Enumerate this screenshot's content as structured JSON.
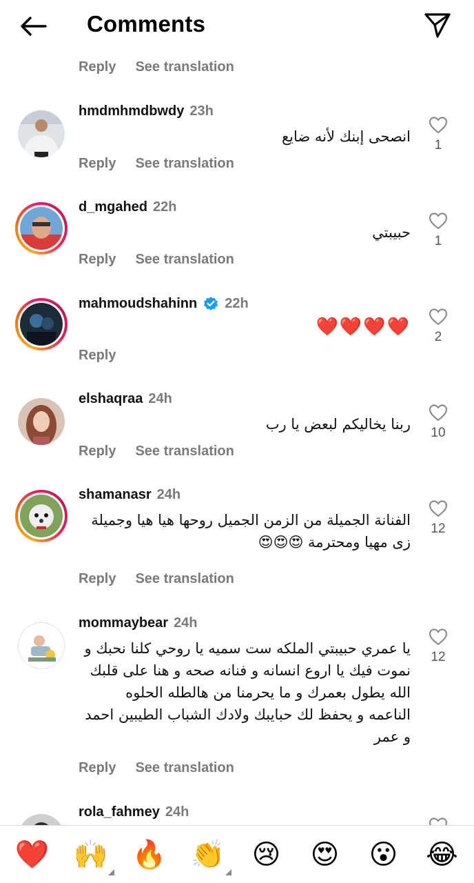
{
  "header": {
    "title": "Comments"
  },
  "reply_label": "Reply",
  "translate_label": "See translation",
  "comments": [
    {
      "username": "hmdmhmdbwdy",
      "time": "23h",
      "text": "انصحى إبنك لأنه ضايع",
      "likes": "1"
    },
    {
      "username": "d_mgahed",
      "time": "22h",
      "text": "حبيبتي",
      "likes": "1"
    },
    {
      "username": "mahmoudshahinn",
      "time": "22h",
      "text": "❤️❤️❤️❤️",
      "likes": "2"
    },
    {
      "username": "elshaqraa",
      "time": "24h",
      "text": "ربنا يخاليكم لبعض يا رب",
      "likes": "10"
    },
    {
      "username": "shamanasr",
      "time": "24h",
      "text": "الفنانة الجميلة من الزمن الجميل روحها هيا هيا وجميلة زى مهيا ومحترمة 😍😍😍",
      "likes": "12"
    },
    {
      "username": "mommaybear",
      "time": "24h",
      "text": "يا عمري حبيبتي الملكه ست سميه يا روحي كلنا نحبك و نموت فيك يا اروع انسانه و فنانه صحه و هنا على قلبك الله يطول بعمرك و ما يحرمنا من هالطله الحلوه الناعمه و يحفظ لك حبايبك ولادك الشباب الطيبين احمد و عمر",
      "likes": "12"
    },
    {
      "username": "rola_fahmey",
      "time": "24h"
    }
  ],
  "emoji_bar": [
    "❤️",
    "🙌",
    "🔥",
    "👏",
    "😢",
    "😍",
    "😮",
    "😂"
  ],
  "colors": {
    "ring_start": "#f9a825",
    "ring_end": "#e91e63",
    "verified": "#1d9bf0",
    "muted": "#7a7a7a"
  }
}
